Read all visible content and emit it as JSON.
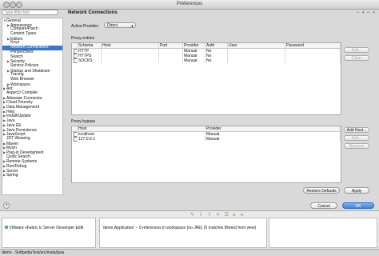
{
  "window": {
    "title": "Preferences"
  },
  "sidebar": {
    "filter_placeholder": "type filter text",
    "items": [
      {
        "label": "General",
        "twisty": "▼",
        "indent": 0
      },
      {
        "label": "Appearance",
        "twisty": "▶",
        "indent": 1
      },
      {
        "label": "Compare/Patch",
        "twisty": "",
        "indent": 1
      },
      {
        "label": "Content Types",
        "twisty": "",
        "indent": 1
      },
      {
        "label": "Editors",
        "twisty": "▶",
        "indent": 1
      },
      {
        "label": "Keys",
        "twisty": "",
        "indent": 1
      },
      {
        "label": "Network Connections",
        "twisty": "",
        "indent": 1,
        "selected": true
      },
      {
        "label": "Perspectives",
        "twisty": "",
        "indent": 1
      },
      {
        "label": "Search",
        "twisty": "",
        "indent": 1
      },
      {
        "label": "Security",
        "twisty": "▶",
        "indent": 1
      },
      {
        "label": "Service Policies",
        "twisty": "",
        "indent": 1
      },
      {
        "label": "Startup and Shutdown",
        "twisty": "▶",
        "indent": 1
      },
      {
        "label": "Tracing",
        "twisty": "",
        "indent": 1
      },
      {
        "label": "Web Browser",
        "twisty": "",
        "indent": 1
      },
      {
        "label": "Workspace",
        "twisty": "▶",
        "indent": 1
      },
      {
        "label": "Ant",
        "twisty": "▶",
        "indent": 0
      },
      {
        "label": "AspectJ Compiler",
        "twisty": "",
        "indent": 0
      },
      {
        "label": "Atlassian Connector",
        "twisty": "▶",
        "indent": 0
      },
      {
        "label": "Cloud Foundry",
        "twisty": "▶",
        "indent": 0
      },
      {
        "label": "Data Management",
        "twisty": "▶",
        "indent": 0
      },
      {
        "label": "Help",
        "twisty": "▶",
        "indent": 0
      },
      {
        "label": "Install/Update",
        "twisty": "▶",
        "indent": 0
      },
      {
        "label": "Java",
        "twisty": "▶",
        "indent": 0
      },
      {
        "label": "Java EE",
        "twisty": "▶",
        "indent": 0
      },
      {
        "label": "Java Persistence",
        "twisty": "▶",
        "indent": 0
      },
      {
        "label": "JavaScript",
        "twisty": "▶",
        "indent": 0
      },
      {
        "label": "JDT Weaving",
        "twisty": "",
        "indent": 0
      },
      {
        "label": "Maven",
        "twisty": "▶",
        "indent": 0
      },
      {
        "label": "Mylyn",
        "twisty": "▶",
        "indent": 0
      },
      {
        "label": "Plug-in Development",
        "twisty": "▶",
        "indent": 0
      },
      {
        "label": "Quick Search",
        "twisty": "",
        "indent": 0
      },
      {
        "label": "Remote Systems",
        "twisty": "▶",
        "indent": 0
      },
      {
        "label": "Run/Debug",
        "twisty": "▶",
        "indent": 0
      },
      {
        "label": "Server",
        "twisty": "▶",
        "indent": 0
      },
      {
        "label": "Spring",
        "twisty": "▶",
        "indent": 0
      }
    ]
  },
  "main": {
    "title": "Network Connections",
    "nav_icons": "⇦ ▾ ⇨ ▾",
    "active_provider_label": "Active Provider:",
    "active_provider_value": "Direct",
    "proxy_entries": {
      "label": "Proxy entries",
      "columns": [
        "Schema",
        "Host",
        "Port",
        "Provider",
        "Auth",
        "User",
        "Password"
      ],
      "rows": [
        [
          "HTTP",
          "",
          "",
          "Manual",
          "No",
          "",
          ""
        ],
        [
          "HTTPS",
          "",
          "",
          "Manual",
          "No",
          "",
          ""
        ],
        [
          "SOCKS",
          "",
          "",
          "Manual",
          "No",
          "",
          ""
        ]
      ],
      "edit_label": "Edit...",
      "clear_label": "Clear"
    },
    "proxy_bypass": {
      "label": "Proxy bypass",
      "columns": [
        "Host",
        "Provider"
      ],
      "rows": [
        [
          "localhost",
          "Manual"
        ],
        [
          "127.0.0.1",
          "Manual"
        ]
      ],
      "add_host_label": "Add Host...",
      "edit_label": "Edit...",
      "remove_label": "Remove"
    },
    "restore_defaults_label": "Restore Defaults",
    "apply_label": "Apply"
  },
  "footer": {
    "help_label": "?",
    "cancel_label": "Cancel",
    "ok_label": "OK"
  },
  "workspace": {
    "left_item": "VMware vFabric tc Server Developer Editi",
    "search_result": "'demo.Application' – 0 references in workspace (no JRE) (0 matches filtered from view)"
  },
  "statusbar": {
    "text": "demo - SoftpediaTest/src/main/java"
  }
}
